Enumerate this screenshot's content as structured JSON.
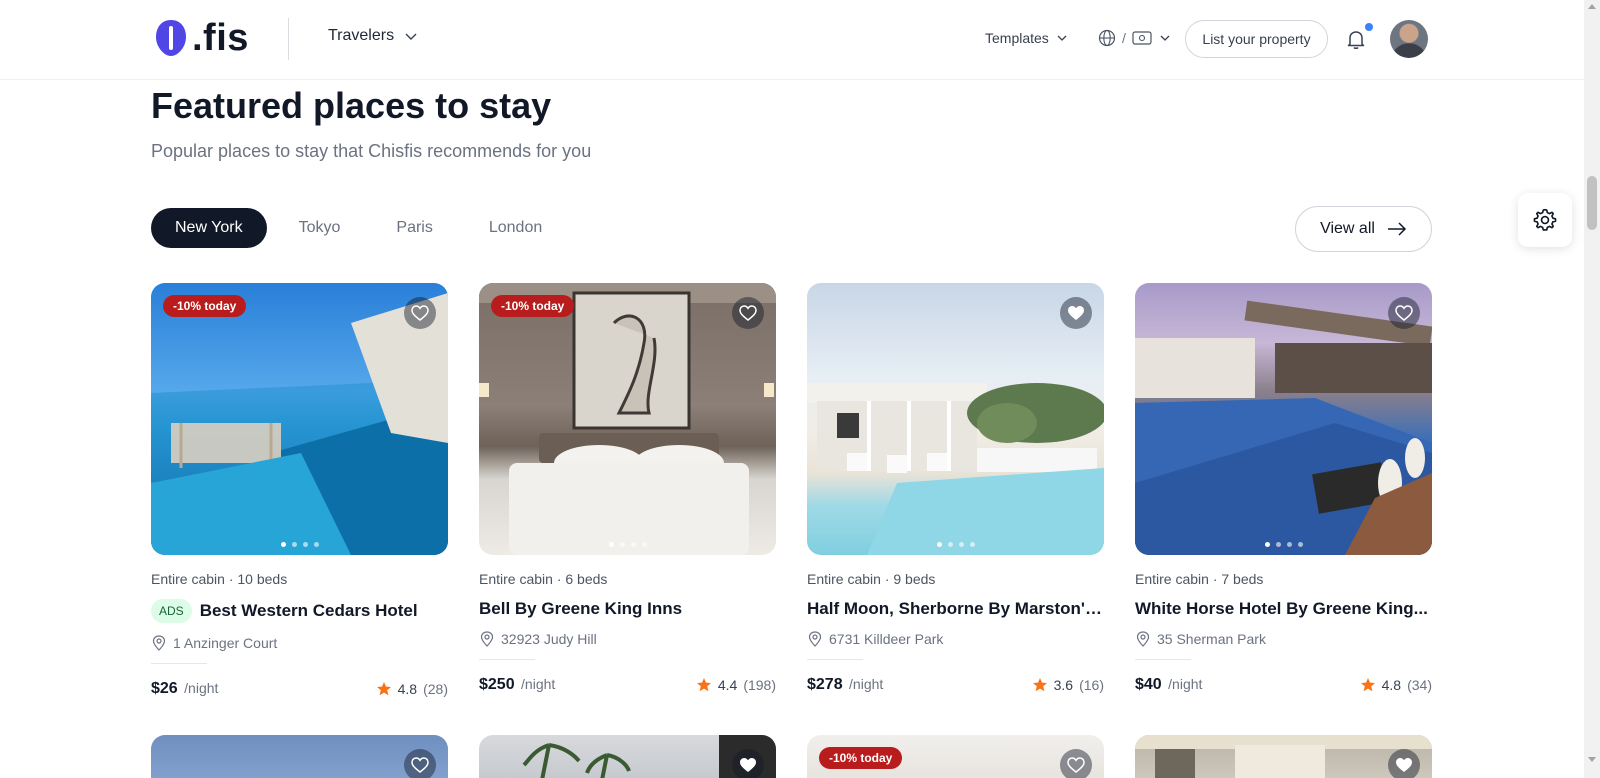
{
  "header": {
    "logo_text": ".fis",
    "travelers_label": "Travelers",
    "templates_label": "Templates",
    "lang_separator": "/",
    "list_property_label": "List your property"
  },
  "section": {
    "title": "Featured places to stay",
    "subtitle": "Popular places to stay that Chisfis recommends for you",
    "tabs": [
      "New York",
      "Tokyo",
      "Paris",
      "London"
    ],
    "active_tab": "New York",
    "view_all_label": "View all"
  },
  "colors": {
    "accent": "#4f46e5",
    "dark": "#111827",
    "badge_red": "#b91c1c",
    "star": "#f97316",
    "ads_bg": "#dcfce7"
  },
  "cards": [
    {
      "badge": "-10% today",
      "meta": "Entire cabin · 10 beds",
      "ads": "ADS",
      "name": "Best Western Cedars Hotel",
      "address": "1 Anzinger Court",
      "price": "$26",
      "per": "/night",
      "rating": "4.8",
      "reviews": "(28)",
      "liked": false
    },
    {
      "badge": "-10% today",
      "meta": "Entire cabin · 6 beds",
      "ads": "",
      "name": "Bell By Greene King Inns",
      "address": "32923 Judy Hill",
      "price": "$250",
      "per": "/night",
      "rating": "4.4",
      "reviews": "(198)",
      "liked": false
    },
    {
      "badge": "",
      "meta": "Entire cabin · 9 beds",
      "ads": "",
      "name": "Half Moon, Sherborne By Marston's...",
      "address": "6731 Killdeer Park",
      "price": "$278",
      "per": "/night",
      "rating": "3.6",
      "reviews": "(16)",
      "liked": true
    },
    {
      "badge": "",
      "meta": "Entire cabin · 7 beds",
      "ads": "",
      "name": "White Horse Hotel By Greene King...",
      "address": "35 Sherman Park",
      "price": "$40",
      "per": "/night",
      "rating": "4.8",
      "reviews": "(34)",
      "liked": false
    }
  ],
  "row2_cards": [
    {
      "badge": "",
      "liked": false
    },
    {
      "badge": "",
      "liked": true
    },
    {
      "badge": "-10% today",
      "liked": false
    },
    {
      "badge": "",
      "liked": true
    }
  ]
}
